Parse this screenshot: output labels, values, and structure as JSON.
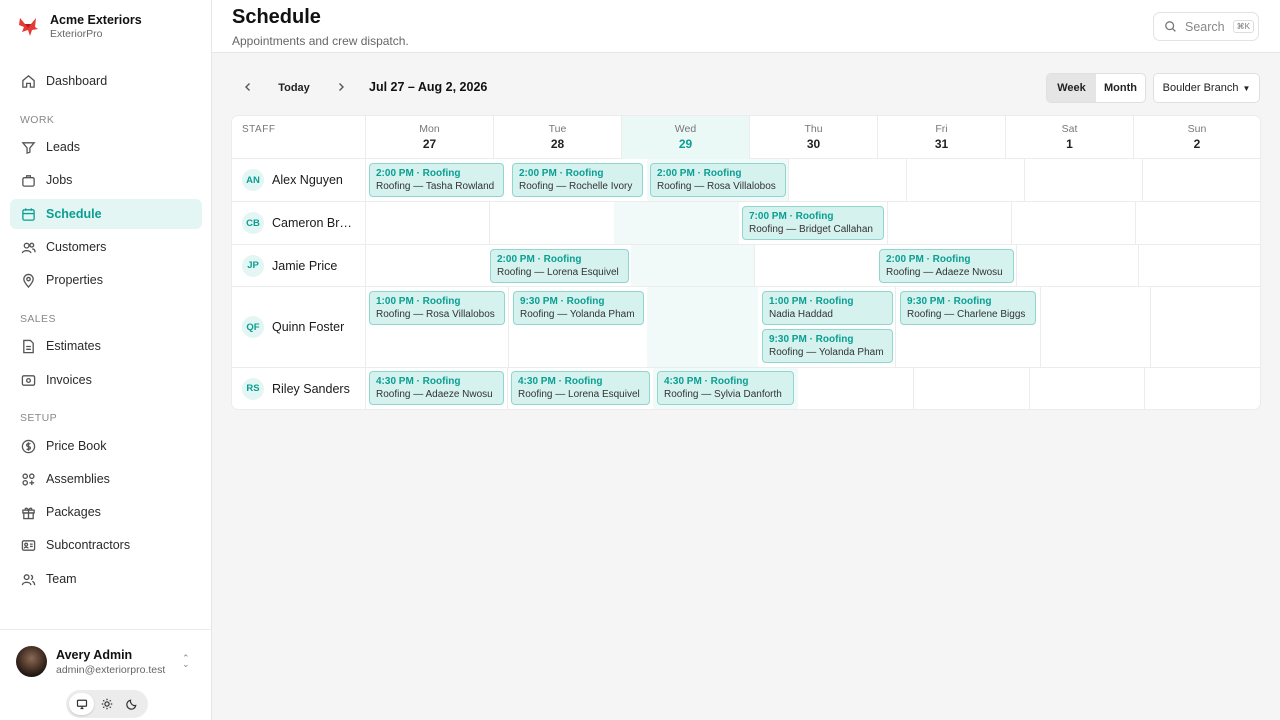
{
  "brand": {
    "name": "Acme Exteriors",
    "product": "ExteriorPro",
    "color": "#e53935"
  },
  "accent": "#0a9e92",
  "nav": {
    "dashboard": "Dashboard",
    "section_work": "WORK",
    "leads": "Leads",
    "jobs": "Jobs",
    "schedule": "Schedule",
    "customers": "Customers",
    "properties": "Properties",
    "section_sales": "SALES",
    "estimates": "Estimates",
    "invoices": "Invoices",
    "section_setup": "SETUP",
    "price_book": "Price Book",
    "assemblies": "Assemblies",
    "packages": "Packages",
    "subcontractors": "Subcontractors",
    "team": "Team",
    "active": "Schedule"
  },
  "user": {
    "name": "Avery Admin",
    "email": "admin@exteriorpro.test"
  },
  "header": {
    "title": "Schedule",
    "subtitle": "Appointments and crew dispatch.",
    "search_label": "Search",
    "search_shortcut": "⌘K"
  },
  "toolbar": {
    "today": "Today",
    "range": "Jul 27 – Aug 2, 2026",
    "week": "Week",
    "month": "Month",
    "view_selected": "Week",
    "branch": "Boulder Branch"
  },
  "calendar": {
    "staff_header": "STAFF",
    "days": [
      {
        "name": "Mon",
        "date": "27"
      },
      {
        "name": "Tue",
        "date": "28"
      },
      {
        "name": "Wed",
        "date": "29",
        "today": true
      },
      {
        "name": "Thu",
        "date": "30"
      },
      {
        "name": "Fri",
        "date": "31"
      },
      {
        "name": "Sat",
        "date": "1"
      },
      {
        "name": "Sun",
        "date": "2"
      }
    ],
    "rows": [
      {
        "initials": "AN",
        "name": "Alex Nguyen",
        "events": [
          {
            "time": "2:00 PM · Roofing",
            "desc": "Roofing — Tasha Rowland"
          },
          {
            "time": "2:00 PM · Roofing",
            "desc": "Roofing — Rochelle Ivory"
          },
          {
            "time": "2:00 PM · Roofing",
            "desc": "Roofing — Rosa Villalobos"
          }
        ]
      },
      {
        "initials": "CB",
        "name": "Cameron Bro…",
        "events": [
          {
            "time": "7:00 PM · Roofing",
            "desc": "Roofing — Bridget Callahan"
          }
        ]
      },
      {
        "initials": "JP",
        "name": "Jamie Price",
        "events": [
          {
            "time": "2:00 PM · Roofing",
            "desc": "Roofing — Lorena Esquivel"
          },
          {
            "time": "2:00 PM · Roofing",
            "desc": "Roofing — Adaeze Nwosu"
          }
        ]
      },
      {
        "initials": "QF",
        "name": "Quinn Foster",
        "events": [
          {
            "time": "1:00 PM · Roofing",
            "desc": "Roofing — Rosa Villalobos"
          },
          {
            "time": "9:30 PM · Roofing",
            "desc": "Roofing — Yolanda Pham"
          },
          {
            "time": "1:00 PM · Roofing",
            "desc": "Nadia Haddad"
          },
          {
            "time": "9:30 PM · Roofing",
            "desc": "Roofing — Yolanda Pham"
          },
          {
            "time": "9:30 PM · Roofing",
            "desc": "Roofing — Charlene Biggs"
          }
        ]
      },
      {
        "initials": "RS",
        "name": "Riley Sanders",
        "events": [
          {
            "time": "4:30 PM · Roofing",
            "desc": "Roofing — Adaeze Nwosu"
          },
          {
            "time": "4:30 PM · Roofing",
            "desc": "Roofing — Lorena Esquivel"
          },
          {
            "time": "4:30 PM · Roofing",
            "desc": "Roofing — Sylvia Danforth"
          }
        ]
      }
    ]
  }
}
